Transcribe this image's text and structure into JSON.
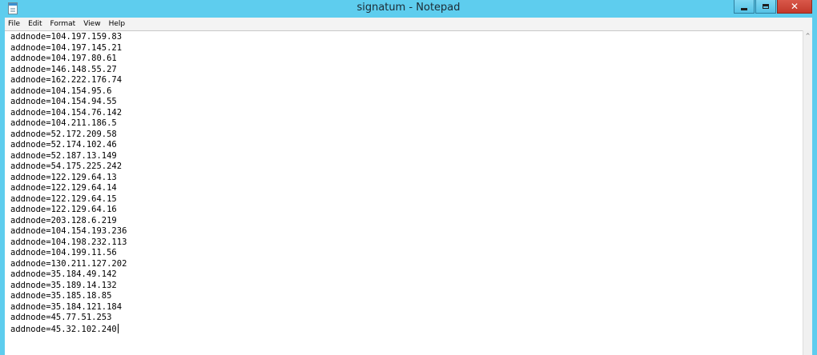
{
  "window": {
    "title": "signatum - Notepad",
    "close_glyph": "✕"
  },
  "menu": [
    {
      "label": "File"
    },
    {
      "label": "Edit"
    },
    {
      "label": "Format"
    },
    {
      "label": "View"
    },
    {
      "label": "Help"
    }
  ],
  "scrollbar": {
    "up_arrow": "^"
  },
  "document": {
    "lines": [
      "addnode=104.197.159.83",
      "addnode=104.197.145.21",
      "addnode=104.197.80.61",
      "addnode=146.148.55.27",
      "addnode=162.222.176.74",
      "addnode=104.154.95.6",
      "addnode=104.154.94.55",
      "addnode=104.154.76.142",
      "addnode=104.211.186.5",
      "addnode=52.172.209.58",
      "addnode=52.174.102.46",
      "addnode=52.187.13.149",
      "addnode=54.175.225.242",
      "addnode=122.129.64.13",
      "addnode=122.129.64.14",
      "addnode=122.129.64.15",
      "addnode=122.129.64.16",
      "addnode=203.128.6.219",
      "addnode=104.154.193.236",
      "addnode=104.198.232.113",
      "addnode=104.199.11.56",
      "addnode=130.211.127.202",
      "addnode=35.184.49.142",
      "addnode=35.189.14.132",
      "addnode=35.185.18.85",
      "addnode=35.184.121.184",
      "addnode=45.77.51.253",
      "addnode=45.32.102.240"
    ]
  },
  "colors": {
    "frame": "#5ecdee",
    "close_button": "#c2392b"
  }
}
